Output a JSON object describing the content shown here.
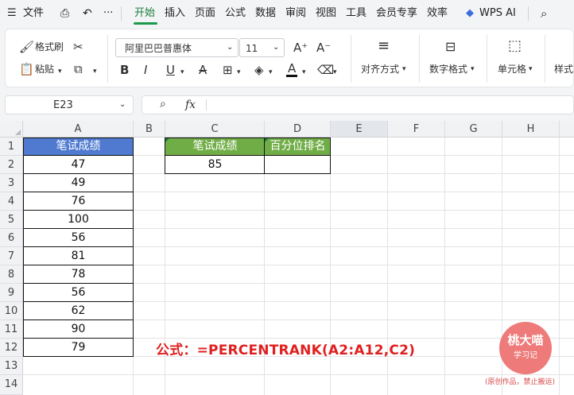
{
  "menubar": {
    "file_label": "文件",
    "more_label": "···",
    "tabs": [
      "开始",
      "插入",
      "页面",
      "公式",
      "数据",
      "审阅",
      "视图",
      "工具",
      "会员专享",
      "效率"
    ],
    "active_tab": "开始",
    "wps_ai_label": "WPS AI"
  },
  "ribbon": {
    "format_painter": "格式刷",
    "paste": "粘贴",
    "font_name": "阿里巴巴普惠体",
    "font_size": "11",
    "align": "对齐方式",
    "number_format": "数字格式",
    "cells": "单元格",
    "styles": "样式"
  },
  "formula_bar": {
    "cell_ref": "E23",
    "fx_label": "fx",
    "formula": ""
  },
  "grid": {
    "columns": [
      "A",
      "B",
      "C",
      "D",
      "E",
      "F",
      "G",
      "H"
    ],
    "selected_column": "E",
    "rows": [
      "1",
      "2",
      "3",
      "4",
      "5",
      "6",
      "7",
      "8",
      "9",
      "10",
      "11",
      "12",
      "13",
      "14"
    ]
  },
  "cells": {
    "a_header": "笔试成绩",
    "a_values": [
      "47",
      "49",
      "76",
      "100",
      "56",
      "81",
      "78",
      "56",
      "62",
      "90",
      "79"
    ],
    "c_header": "笔试成绩",
    "c_value": "85",
    "d_header": "百分位排名",
    "d_value": ""
  },
  "colors": {
    "header_blue": "#4f7ad0",
    "header_green": "#70ad47",
    "formula_red": "#e02020",
    "active_tab_green": "#1a9a4a"
  },
  "annotation": {
    "formula_text": "公式：=PERCENTRANK(A2:A12,C2)"
  },
  "watermark": {
    "name": "桃大喵",
    "subtitle": "学习记",
    "note": "(原创作品，禁止搬运)"
  }
}
